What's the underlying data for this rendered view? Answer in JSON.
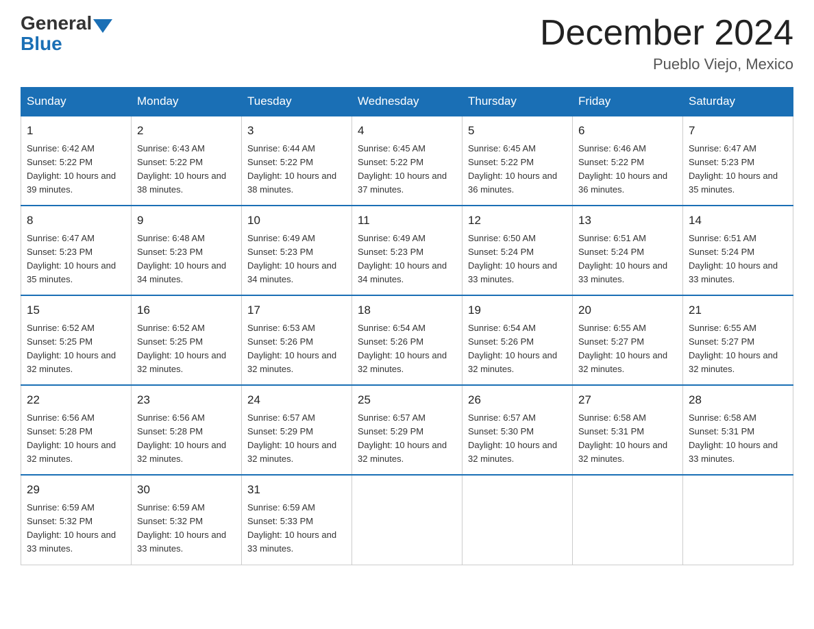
{
  "header": {
    "logo_general": "General",
    "logo_blue": "Blue",
    "month_title": "December 2024",
    "location": "Pueblo Viejo, Mexico"
  },
  "weekdays": [
    "Sunday",
    "Monday",
    "Tuesday",
    "Wednesday",
    "Thursday",
    "Friday",
    "Saturday"
  ],
  "weeks": [
    [
      {
        "day": "1",
        "sunrise": "6:42 AM",
        "sunset": "5:22 PM",
        "daylight": "10 hours and 39 minutes."
      },
      {
        "day": "2",
        "sunrise": "6:43 AM",
        "sunset": "5:22 PM",
        "daylight": "10 hours and 38 minutes."
      },
      {
        "day": "3",
        "sunrise": "6:44 AM",
        "sunset": "5:22 PM",
        "daylight": "10 hours and 38 minutes."
      },
      {
        "day": "4",
        "sunrise": "6:45 AM",
        "sunset": "5:22 PM",
        "daylight": "10 hours and 37 minutes."
      },
      {
        "day": "5",
        "sunrise": "6:45 AM",
        "sunset": "5:22 PM",
        "daylight": "10 hours and 36 minutes."
      },
      {
        "day": "6",
        "sunrise": "6:46 AM",
        "sunset": "5:22 PM",
        "daylight": "10 hours and 36 minutes."
      },
      {
        "day": "7",
        "sunrise": "6:47 AM",
        "sunset": "5:23 PM",
        "daylight": "10 hours and 35 minutes."
      }
    ],
    [
      {
        "day": "8",
        "sunrise": "6:47 AM",
        "sunset": "5:23 PM",
        "daylight": "10 hours and 35 minutes."
      },
      {
        "day": "9",
        "sunrise": "6:48 AM",
        "sunset": "5:23 PM",
        "daylight": "10 hours and 34 minutes."
      },
      {
        "day": "10",
        "sunrise": "6:49 AM",
        "sunset": "5:23 PM",
        "daylight": "10 hours and 34 minutes."
      },
      {
        "day": "11",
        "sunrise": "6:49 AM",
        "sunset": "5:23 PM",
        "daylight": "10 hours and 34 minutes."
      },
      {
        "day": "12",
        "sunrise": "6:50 AM",
        "sunset": "5:24 PM",
        "daylight": "10 hours and 33 minutes."
      },
      {
        "day": "13",
        "sunrise": "6:51 AM",
        "sunset": "5:24 PM",
        "daylight": "10 hours and 33 minutes."
      },
      {
        "day": "14",
        "sunrise": "6:51 AM",
        "sunset": "5:24 PM",
        "daylight": "10 hours and 33 minutes."
      }
    ],
    [
      {
        "day": "15",
        "sunrise": "6:52 AM",
        "sunset": "5:25 PM",
        "daylight": "10 hours and 32 minutes."
      },
      {
        "day": "16",
        "sunrise": "6:52 AM",
        "sunset": "5:25 PM",
        "daylight": "10 hours and 32 minutes."
      },
      {
        "day": "17",
        "sunrise": "6:53 AM",
        "sunset": "5:26 PM",
        "daylight": "10 hours and 32 minutes."
      },
      {
        "day": "18",
        "sunrise": "6:54 AM",
        "sunset": "5:26 PM",
        "daylight": "10 hours and 32 minutes."
      },
      {
        "day": "19",
        "sunrise": "6:54 AM",
        "sunset": "5:26 PM",
        "daylight": "10 hours and 32 minutes."
      },
      {
        "day": "20",
        "sunrise": "6:55 AM",
        "sunset": "5:27 PM",
        "daylight": "10 hours and 32 minutes."
      },
      {
        "day": "21",
        "sunrise": "6:55 AM",
        "sunset": "5:27 PM",
        "daylight": "10 hours and 32 minutes."
      }
    ],
    [
      {
        "day": "22",
        "sunrise": "6:56 AM",
        "sunset": "5:28 PM",
        "daylight": "10 hours and 32 minutes."
      },
      {
        "day": "23",
        "sunrise": "6:56 AM",
        "sunset": "5:28 PM",
        "daylight": "10 hours and 32 minutes."
      },
      {
        "day": "24",
        "sunrise": "6:57 AM",
        "sunset": "5:29 PM",
        "daylight": "10 hours and 32 minutes."
      },
      {
        "day": "25",
        "sunrise": "6:57 AM",
        "sunset": "5:29 PM",
        "daylight": "10 hours and 32 minutes."
      },
      {
        "day": "26",
        "sunrise": "6:57 AM",
        "sunset": "5:30 PM",
        "daylight": "10 hours and 32 minutes."
      },
      {
        "day": "27",
        "sunrise": "6:58 AM",
        "sunset": "5:31 PM",
        "daylight": "10 hours and 32 minutes."
      },
      {
        "day": "28",
        "sunrise": "6:58 AM",
        "sunset": "5:31 PM",
        "daylight": "10 hours and 33 minutes."
      }
    ],
    [
      {
        "day": "29",
        "sunrise": "6:59 AM",
        "sunset": "5:32 PM",
        "daylight": "10 hours and 33 minutes."
      },
      {
        "day": "30",
        "sunrise": "6:59 AM",
        "sunset": "5:32 PM",
        "daylight": "10 hours and 33 minutes."
      },
      {
        "day": "31",
        "sunrise": "6:59 AM",
        "sunset": "5:33 PM",
        "daylight": "10 hours and 33 minutes."
      },
      null,
      null,
      null,
      null
    ]
  ]
}
